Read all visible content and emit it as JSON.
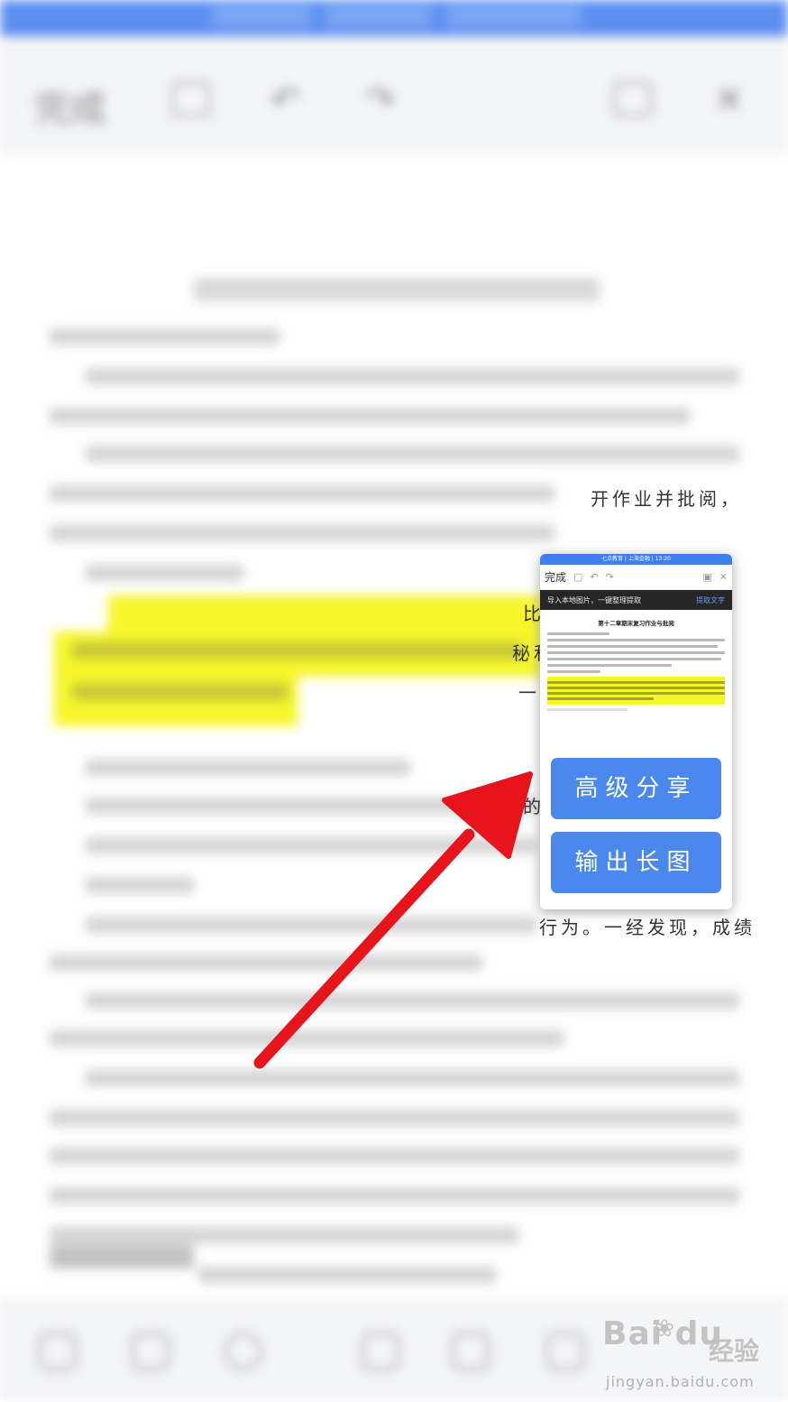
{
  "preview": {
    "status_text": "七点教育 | 上海金融 | 13:20",
    "toolbar": {
      "done_label": "完成"
    },
    "banner": {
      "text": "导入本地图片，一键整理提取",
      "link": "提取文字"
    },
    "doc_title": "第十二章期末复习作业与批阅",
    "actions": {
      "share_label": "高级分享",
      "long_image_label": "输出长图"
    }
  },
  "background": {
    "toolbar_left": "完成",
    "fragments": [
      "开作业并批阅，",
      "比",
      "秘和",
      "一",
      "的",
      "行为。一经发现，成绩"
    ]
  },
  "watermark": {
    "logo": "Bai du",
    "cn": "经验",
    "url": "jingyan.baidu.com"
  },
  "colors": {
    "accent": "#4a88ee",
    "highlight": "#f6f62a",
    "arrow": "#e8141c"
  }
}
